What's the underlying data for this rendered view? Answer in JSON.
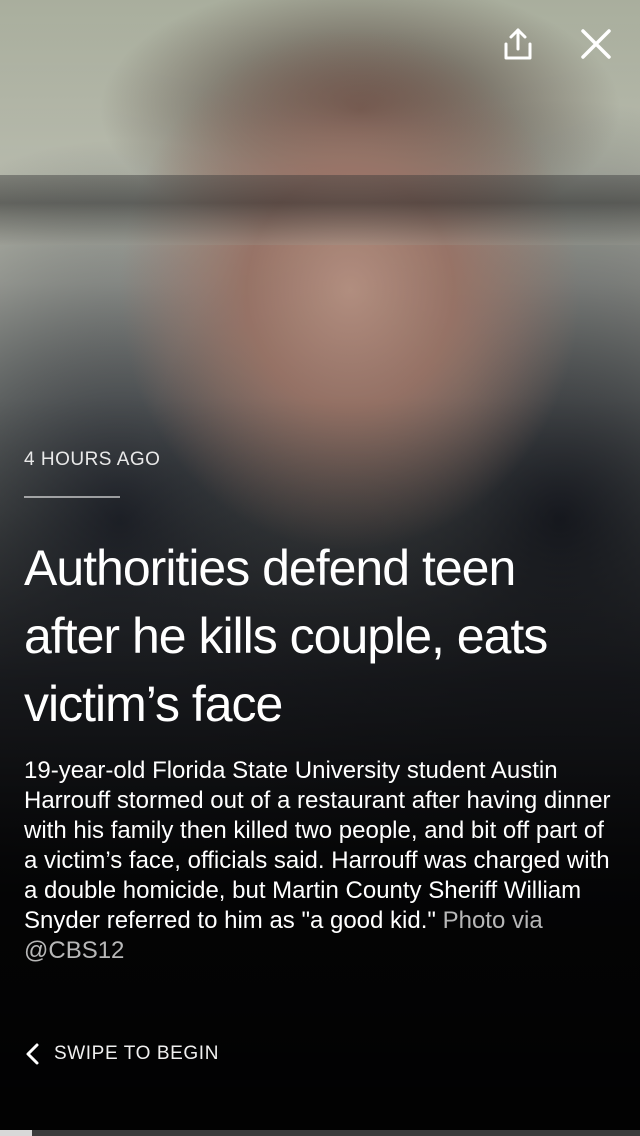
{
  "story": {
    "timestamp": "4 HOURS AGO",
    "headline": "Authorities defend teen after he kills couple, eats victim’s face",
    "summary": "19-year-old Florida State University student Austin Harrouff stormed out of a restaurant after having dinner with his family then killed two people, and bit off part of a victim’s face, officials said. Harrouff was charged with a double homicide, but Martin County Sheriff William Snyder referred to him as \"a good kid.\"",
    "photo_credit": "Photo via @CBS12"
  },
  "actions": {
    "share_icon": "share-icon",
    "close_icon": "close-icon"
  },
  "footer": {
    "swipe_label": "SWIPE TO BEGIN",
    "chevron_icon": "chevron-left-icon"
  },
  "progress": {
    "fraction": 0.05
  }
}
